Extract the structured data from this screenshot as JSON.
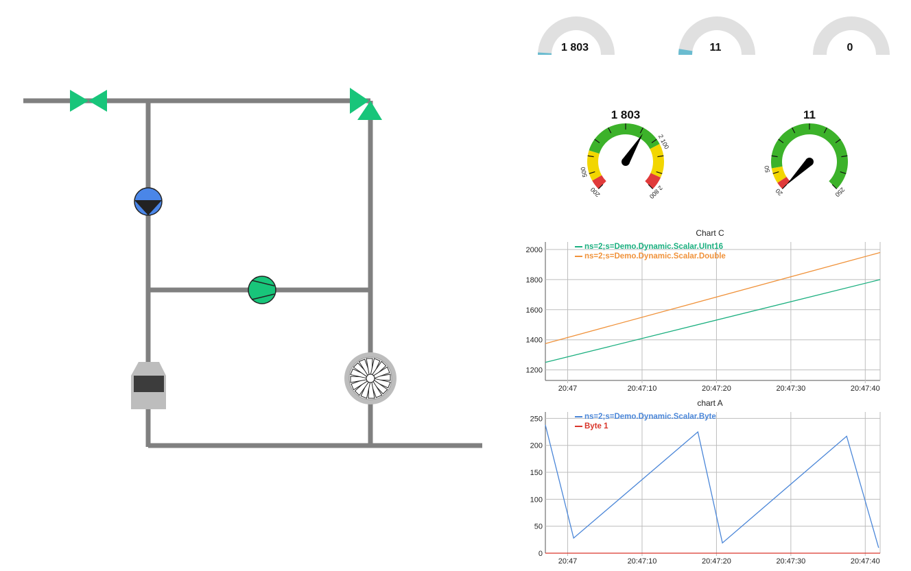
{
  "colors": {
    "pipe": "#808080",
    "valve": "#18c57a",
    "pump_blue": "#4a86e8",
    "pump_green": "#18c57a",
    "gauge_bg": "#e0e0e0",
    "gauge_fill": "#6bbcd0",
    "zone_green": "#3cb22a",
    "zone_yellow": "#f2d600",
    "zone_red": "#e03a3a"
  },
  "icons": [
    "butterfly-valve-icon",
    "three-way-valve-icon",
    "blue-pump-icon",
    "green-pump-icon",
    "filter-tank-icon",
    "fan-icon"
  ],
  "semi_gauges": [
    {
      "value": "1 803",
      "fill_fraction": 0.02
    },
    {
      "value": "11",
      "fill_fraction": 0.05
    },
    {
      "value": "0",
      "fill_fraction": 0.0
    }
  ],
  "dial_gauges": [
    {
      "value": "1 803",
      "min": 200,
      "max": 2800,
      "needle": 1803,
      "labels": [
        "200",
        "500",
        "2 100",
        "2 800"
      ],
      "zones": [
        {
          "from": 200,
          "to": 350,
          "color": "red"
        },
        {
          "from": 350,
          "to": 800,
          "color": "yellow"
        },
        {
          "from": 800,
          "to": 2100,
          "color": "green"
        },
        {
          "from": 2100,
          "to": 2600,
          "color": "yellow"
        },
        {
          "from": 2600,
          "to": 2800,
          "color": "red"
        }
      ]
    },
    {
      "value": "11",
      "min": 20,
      "max": 250,
      "needle": 11,
      "labels": [
        "20",
        "50",
        "250"
      ],
      "zones": [
        {
          "from": 20,
          "to": 30,
          "color": "red"
        },
        {
          "from": 30,
          "to": 50,
          "color": "yellow"
        },
        {
          "from": 50,
          "to": 250,
          "color": "green"
        }
      ]
    }
  ],
  "chart_data": [
    {
      "type": "line",
      "title": "Chart C",
      "x_ticks": [
        "20:47",
        "20:47:10",
        "20:47:20",
        "20:47:30",
        "20:47:40"
      ],
      "x_range_seconds": [
        -3,
        42
      ],
      "ylim": [
        1130,
        2050
      ],
      "y_ticks": [
        1200,
        1400,
        1600,
        1800,
        2000
      ],
      "grid": true,
      "legend_position": "top-left",
      "series": [
        {
          "name": "ns=2;s=Demo.Dynamic.Scalar.UInt16",
          "color": "#1aaf7f",
          "points": [
            [
              -3,
              1250
            ],
            [
              42,
              1800
            ]
          ]
        },
        {
          "name": "ns=2;s=Demo.Dynamic.Scalar.Double",
          "color": "#f0923a",
          "points": [
            [
              -3,
              1375
            ],
            [
              42,
              1980
            ]
          ]
        }
      ]
    },
    {
      "type": "line",
      "title": "chart A",
      "x_ticks": [
        "20:47",
        "20:47:10",
        "20:47:20",
        "20:47:30",
        "20:47:40"
      ],
      "x_range_seconds": [
        -3,
        42
      ],
      "ylim": [
        0,
        262
      ],
      "y_ticks": [
        0,
        50,
        100,
        150,
        200,
        250
      ],
      "grid": true,
      "legend_position": "top-left",
      "series": [
        {
          "name": "ns=2;s=Demo.Dynamic.Scalar.Byte",
          "color": "#4a86d8",
          "points": [
            [
              -3,
              238
            ],
            [
              0.8,
              28
            ],
            [
              17.5,
              225
            ],
            [
              20.8,
              19
            ],
            [
              37.5,
              217
            ],
            [
              41.8,
              10
            ]
          ]
        },
        {
          "name": "Byte 1",
          "color": "#d9352a",
          "points": [
            [
              -3,
              0
            ],
            [
              42,
              0
            ]
          ]
        }
      ]
    }
  ]
}
